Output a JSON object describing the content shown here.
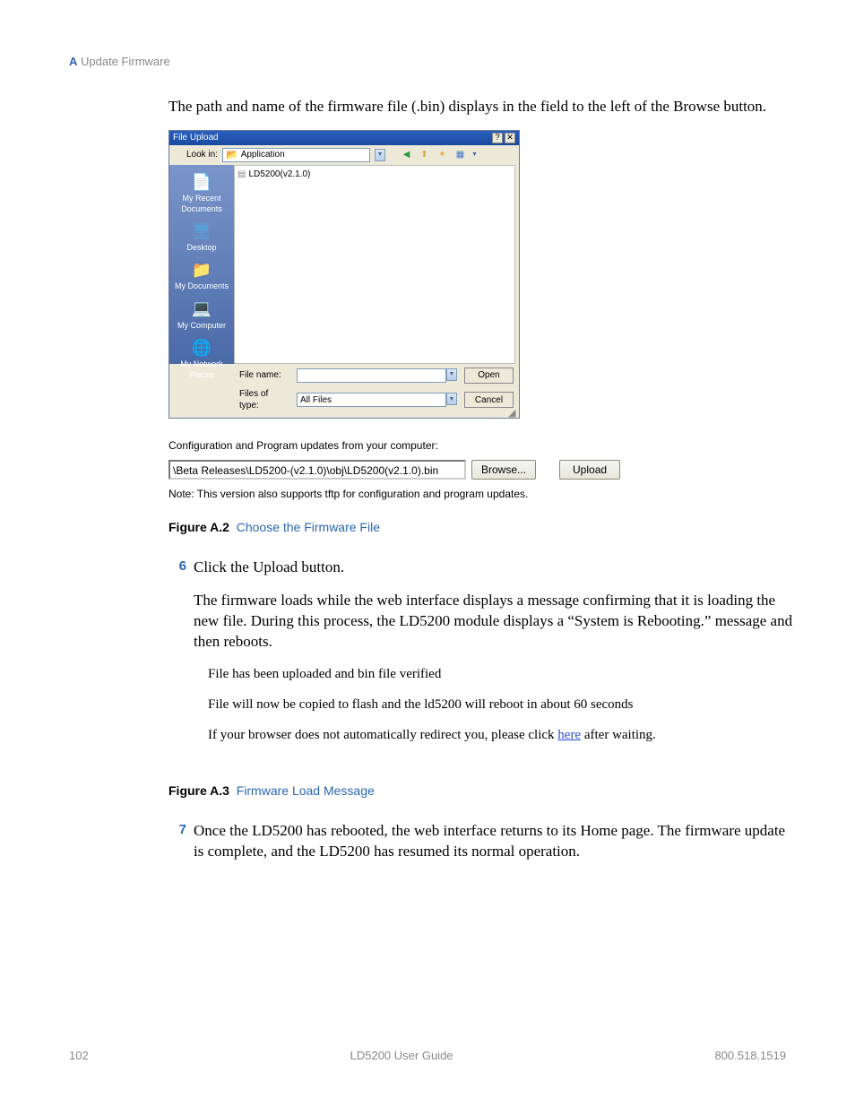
{
  "header": {
    "appendix": "A",
    "title": "Update Firmware"
  },
  "intro": "The path and name of the firmware file (.bin) displays in the field to the left of the Browse button.",
  "dialog": {
    "title": "File Upload",
    "look_in_label": "Look in:",
    "look_in_value": "Application",
    "file_item": "LD5200(v2.1.0)",
    "places": [
      {
        "name": "recent",
        "label": "My Recent Documents",
        "icon": "📄"
      },
      {
        "name": "desktop",
        "label": "Desktop",
        "icon": "🖥"
      },
      {
        "name": "mydocs",
        "label": "My Documents",
        "icon": "📁"
      },
      {
        "name": "mycomputer",
        "label": "My Computer",
        "icon": "💻"
      },
      {
        "name": "network",
        "label": "My Network Places",
        "icon": "🌐"
      }
    ],
    "filename_label": "File name:",
    "filename_value": "",
    "filetype_label": "Files of type:",
    "filetype_value": "All Files",
    "open": "Open",
    "cancel": "Cancel"
  },
  "config": {
    "heading": "Configuration and Program updates from your computer:",
    "path": "\\Beta Releases\\LD5200-(v2.1.0)\\obj\\LD5200(v2.1.0).bin",
    "browse": "Browse...",
    "upload": "Upload",
    "note": "Note: This version also supports tftp for configuration and program updates."
  },
  "fig2": {
    "label": "Figure A.2",
    "text": "Choose the Firmware File"
  },
  "step6": {
    "num": "6",
    "line1": "Click the Upload button.",
    "line2": "The firmware loads while the web interface displays a message confirming that it is loading the new file. During this process, the LD5200 module displays a “System is Rebooting.” message and then reboots."
  },
  "msg": {
    "l1": "File has been uploaded and bin file verified",
    "l2": "File will now be copied to flash and the ld5200 will reboot in about 60 seconds",
    "l3a": "If your browser does not automatically redirect you, please click ",
    "l3link": "here",
    "l3b": " after waiting."
  },
  "fig3": {
    "label": "Figure A.3",
    "text": "Firmware Load Message"
  },
  "step7": {
    "num": "7",
    "line": "Once the LD5200 has rebooted, the web interface returns to its Home page. The firmware update is complete, and the LD5200 has resumed its normal operation."
  },
  "footer": {
    "page": "102",
    "center": "LD5200 User Guide",
    "right": "800.518.1519"
  }
}
